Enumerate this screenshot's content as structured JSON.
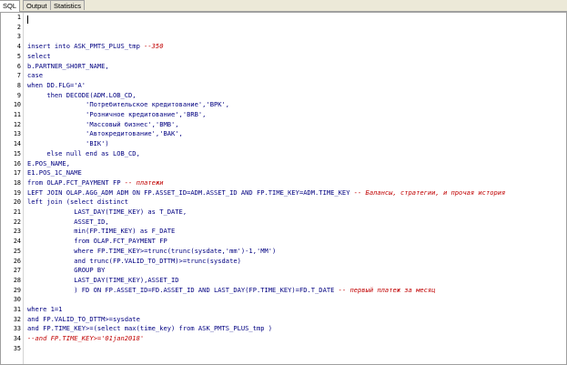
{
  "tabs": [
    "SQL",
    "Output",
    "Statistics"
  ],
  "active_tab": "SQL",
  "editor": {
    "lines": [
      {
        "n": "1",
        "parts": [
          {
            "t": "",
            "c": false
          }
        ]
      },
      {
        "n": "2",
        "parts": [
          {
            "t": "",
            "c": false
          }
        ]
      },
      {
        "n": "3",
        "parts": [
          {
            "t": "",
            "c": false
          }
        ]
      },
      {
        "n": "4",
        "parts": [
          {
            "t": "insert into ASK_PMTS_PLUS_tmp ",
            "c": false
          },
          {
            "t": "--350",
            "c": true
          }
        ]
      },
      {
        "n": "5",
        "parts": [
          {
            "t": "select",
            "c": false
          }
        ]
      },
      {
        "n": "6",
        "parts": [
          {
            "t": "b.PARTNER_SHORT_NAME,",
            "c": false
          }
        ]
      },
      {
        "n": "7",
        "parts": [
          {
            "t": "case",
            "c": false
          }
        ]
      },
      {
        "n": "8",
        "parts": [
          {
            "t": "when DD.FLG='A'",
            "c": false
          }
        ]
      },
      {
        "n": "9",
        "parts": [
          {
            "t": "     then DECODE(ADM.LOB_CD,",
            "c": false
          }
        ]
      },
      {
        "n": "10",
        "parts": [
          {
            "t": "               'Потребительское кредитование','BPK',",
            "c": false
          }
        ]
      },
      {
        "n": "11",
        "parts": [
          {
            "t": "               'Розничное кредитование','BRB',",
            "c": false
          }
        ]
      },
      {
        "n": "12",
        "parts": [
          {
            "t": "               'Массовый бизнес','BMB',",
            "c": false
          }
        ]
      },
      {
        "n": "13",
        "parts": [
          {
            "t": "               'Автокредитование','BAK',",
            "c": false
          }
        ]
      },
      {
        "n": "14",
        "parts": [
          {
            "t": "               'BIK')",
            "c": false
          }
        ]
      },
      {
        "n": "15",
        "parts": [
          {
            "t": "     else null end as LOB_CD,",
            "c": false
          }
        ]
      },
      {
        "n": "16",
        "parts": [
          {
            "t": "E.POS_NAME,",
            "c": false
          }
        ]
      },
      {
        "n": "17",
        "parts": [
          {
            "t": "E1.POS_1C_NAME",
            "c": false
          }
        ]
      },
      {
        "n": "18",
        "parts": [
          {
            "t": "from OLAP.FCT_PAYMENT FP ",
            "c": false
          },
          {
            "t": "-- платежи",
            "c": true
          }
        ]
      },
      {
        "n": "19",
        "parts": [
          {
            "t": "LEFT JOIN OLAP.AGG_ADM ADM ON FP.ASSET_ID=ADM.ASSET_ID AND FP.TIME_KEY=ADM.TIME_KEY ",
            "c": false
          },
          {
            "t": "-- Балансы, стратегии, и прочая история",
            "c": true
          }
        ]
      },
      {
        "n": "20",
        "parts": [
          {
            "t": "left join (select distinct",
            "c": false
          }
        ]
      },
      {
        "n": "21",
        "parts": [
          {
            "t": "            LAST_DAY(TIME_KEY) as T_DATE,",
            "c": false
          }
        ]
      },
      {
        "n": "22",
        "parts": [
          {
            "t": "            ASSET_ID,",
            "c": false
          }
        ]
      },
      {
        "n": "23",
        "parts": [
          {
            "t": "            min(FP.TIME_KEY) as F_DATE",
            "c": false
          }
        ]
      },
      {
        "n": "24",
        "parts": [
          {
            "t": "            from OLAP.FCT_PAYMENT FP",
            "c": false
          }
        ]
      },
      {
        "n": "25",
        "parts": [
          {
            "t": "            where FP.TIME_KEY>=trunc(trunc(sysdate,'mm')-1,'MM')",
            "c": false
          }
        ]
      },
      {
        "n": "26",
        "parts": [
          {
            "t": "            and trunc(FP.VALID_TO_DTTM)>=trunc(sysdate)",
            "c": false
          }
        ]
      },
      {
        "n": "27",
        "parts": [
          {
            "t": "            GROUP BY",
            "c": false
          }
        ]
      },
      {
        "n": "28",
        "parts": [
          {
            "t": "            LAST_DAY(TIME_KEY),ASSET_ID",
            "c": false
          }
        ]
      },
      {
        "n": "29",
        "parts": [
          {
            "t": "            ) FD ON FP.ASSET_ID=FD.ASSET_ID AND LAST_DAY(FP.TIME_KEY)=FD.T_DATE ",
            "c": false
          },
          {
            "t": "-- первый платеж за месяц",
            "c": true
          }
        ]
      },
      {
        "n": "30",
        "parts": [
          {
            "t": "",
            "c": false
          }
        ]
      },
      {
        "n": "31",
        "parts": [
          {
            "t": "where 1=1",
            "c": false
          }
        ]
      },
      {
        "n": "32",
        "parts": [
          {
            "t": "and FP.VALID_TO_DTTM>=sysdate",
            "c": false
          }
        ]
      },
      {
        "n": "33",
        "parts": [
          {
            "t": "and FP.TIME_KEY>=(select max(time_key) from ASK_PMTS_PLUS_tmp )",
            "c": false
          }
        ]
      },
      {
        "n": "34",
        "parts": [
          {
            "t": "--and FP.TIME_KEY>='01jan2018'",
            "c": true
          }
        ]
      },
      {
        "n": "35",
        "parts": [
          {
            "t": "",
            "c": false
          }
        ]
      }
    ]
  },
  "colors": {
    "code": "#000080",
    "comment": "#c00000",
    "line_number": "#000000"
  }
}
